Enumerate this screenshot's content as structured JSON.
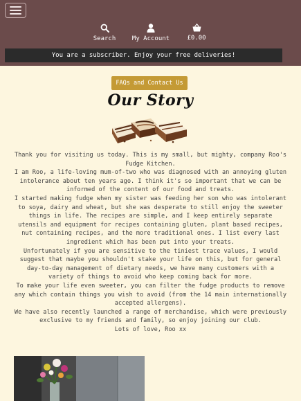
{
  "nav": {
    "search_label": "Search",
    "account_label": "My Account",
    "basket_total": "£0.00"
  },
  "banner": {
    "text": "You are a subscriber. Enjoy your free deliveries!"
  },
  "faq_button": {
    "label": "FAQs and Contact Us"
  },
  "page_title": "Our Story",
  "story": {
    "paragraphs": [
      "Thank you for visiting us today. This is my small, but mighty, company Roo's Fudge Kitchen.",
      "I am Roo, a life-loving mum-of-two who was diagnosed with an annoying gluten intolerance about ten years ago. I think it's so important that we can be informed of the content of our food and treats.",
      "I started making fudge when my sister was feeding her son who was intolerant to soya, dairy and wheat, but she was desperate to still enjoy the sweeter things in life. The recipes are simple, and I keep entirely separate utensils and equipment for recipes containing gluten, plant based recipes, nut containing recipes, and the more traditional ones. I list every last ingredient which has been put into your treats.",
      "Unfortunately if you are sensitive to the tiniest trace values, I would suggest that maybe you shouldn't stake your life on this, but for general day-to-day management of dietary needs, we have many customers with a variety of things to avoid who keep coming back for more.",
      "To make your life even sweeter, you can filter the fudge products to remove any which contain things you wish to avoid (from the 14 main internationally accepted allergens).",
      "We have also recently launched a range of merchandise, which were previously exclusive to my friends and family, so enjoy joining our club.",
      "Lots of love, Roo xx"
    ]
  },
  "colors": {
    "header_bg": "#6b4b4b",
    "page_bg": "#fdf6df",
    "banner_bg": "#2b2b2b",
    "accent": "#c49a35"
  },
  "icons": {
    "menu": "hamburger-icon",
    "search": "search-icon",
    "account": "user-icon",
    "basket": "shopping-basket-icon"
  }
}
